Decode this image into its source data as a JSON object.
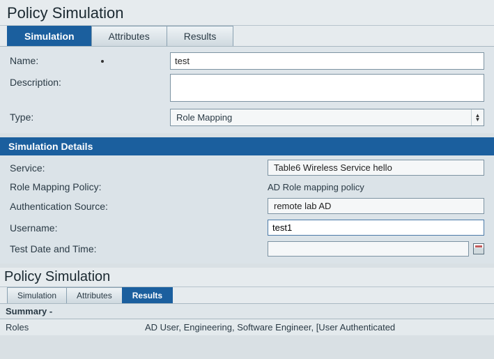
{
  "upper": {
    "title": "Policy Simulation",
    "tabs": [
      "Simulation",
      "Attributes",
      "Results"
    ],
    "active_tab": 0,
    "form": {
      "name_label": "Name:",
      "name_value": "test",
      "description_label": "Description:",
      "description_value": "",
      "type_label": "Type:",
      "type_value": "Role Mapping"
    },
    "details_header": "Simulation Details",
    "details": {
      "service_label": "Service:",
      "service_value": "Table6 Wireless Service hello",
      "rmp_label": "Role Mapping Policy:",
      "rmp_value": "AD Role mapping policy",
      "auth_label": "Authentication Source:",
      "auth_value": "remote lab AD",
      "user_label": "Username:",
      "user_value": "test1",
      "date_label": "Test Date and Time:",
      "date_value": ""
    }
  },
  "lower": {
    "title": "Policy Simulation",
    "tabs": [
      "Simulation",
      "Attributes",
      "Results"
    ],
    "active_tab": 2,
    "summary_label": "Summary -",
    "roles_label": "Roles",
    "roles_value": "AD User, Engineering, Software Engineer, [User Authenticated"
  }
}
